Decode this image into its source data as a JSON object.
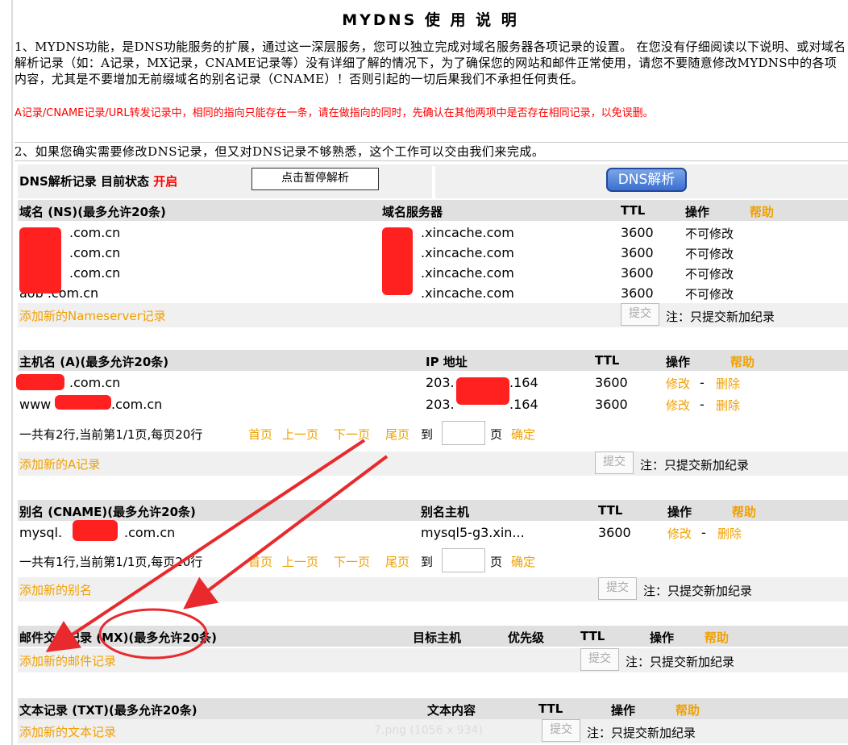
{
  "title": "MYDNS 使 用 说 明",
  "notice": {
    "para1": "1、MYDNS功能，是DNS功能服务的扩展，通过这一深层服务，您可以独立完成对域名服务器各项记录的设置。 在您没有仔细阅读以下说明、或对域名解析记录（如：A记录，MX记录，CNAME记录等）没有详细了解的情况下，为了确保您的网站和邮件正常使用，请您不要随意修改MYDNS中的各项内容，尤其是不要增加无前缀域名的别名记录（CNAME）！否则引起的一切后果我们不承担任何责任。",
    "red": "A记录/CNAME记录/URL转发记录中，相同的指向只能存在一条，请在做指向的同时，先确认在其他两项中是否存在相同记录，以免误删。",
    "para2": "2、如果您确实需要修改DNS记录，但又对DNS记录不够熟悉，这个工作可以交由我们来完成。"
  },
  "status": {
    "label": "DNS解析记录  目前状态",
    "state": "开启",
    "pause_button": "点击暂停解析",
    "dns_button": "DNS解析"
  },
  "ns": {
    "headers": [
      "域名 (NS)(最多允许20条)",
      "域名服务器",
      "TTL",
      "操作",
      "帮助"
    ],
    "rows": [
      {
        "domain": ".com.cn",
        "server": ".xincache.com",
        "ttl": "3600",
        "op": "不可修改"
      },
      {
        "domain": ".com.cn",
        "server": ".xincache.com",
        "ttl": "3600",
        "op": "不可修改"
      },
      {
        "domain": ".com.cn",
        "server": ".xincache.com",
        "ttl": "3600",
        "op": "不可修改"
      },
      {
        "domain": "aob .com.cn",
        "server": ".xincache.com",
        "ttl": "3600",
        "op": "不可修改"
      }
    ],
    "add": "添加新的Nameserver记录",
    "submit": "提交",
    "note": "注：只提交新加纪录"
  },
  "a": {
    "headers": [
      "主机名 (A)(最多允许20条)",
      "IP 地址",
      "TTL",
      "操作",
      "帮助"
    ],
    "rows": [
      {
        "host": ".com.cn",
        "ip": "203.",
        "ip_end": ".164",
        "ttl": "3600",
        "edit": "修改",
        "sep": "-",
        "del": "删除"
      },
      {
        "host": "www",
        "host_end": ".com.cn",
        "ip": "203.",
        "ip_end": ".164",
        "ttl": "3600",
        "edit": "修改",
        "sep": "-",
        "del": "删除"
      }
    ],
    "pager": {
      "info": "一共有2行,当前第1/1页,每页20行",
      "first": "首页",
      "prev": "上一页",
      "next": "下一页",
      "last": "尾页",
      "to": "到",
      "page": "页",
      "go": "确定"
    },
    "add": "添加新的A记录",
    "submit": "提交",
    "note": "注：只提交新加纪录"
  },
  "cname": {
    "headers": [
      "别名 (CNAME)(最多允许20条)",
      "别名主机",
      "TTL",
      "操作",
      "帮助"
    ],
    "rows": [
      {
        "alias": "mysql.",
        "alias_end": ".com.cn",
        "target": "mysql5-g3.xin...",
        "ttl": "3600",
        "edit": "修改",
        "sep": "-",
        "del": "删除"
      }
    ],
    "pager": {
      "info": "一共有1行,当前第1/1页,每页20行",
      "first": "首页",
      "prev": "上一页",
      "next": "下一页",
      "last": "尾页",
      "to": "到",
      "page": "页",
      "go": "确定"
    },
    "add": "添加新的别名",
    "submit": "提交",
    "note": "注：只提交新加纪录"
  },
  "mx": {
    "headers": [
      "邮件交换记录 (MX)(最多允许20条)",
      "目标主机",
      "优先级",
      "TTL",
      "操作",
      "帮助"
    ],
    "add": "添加新的邮件记录",
    "submit": "提交",
    "note": "注：只提交新加纪录"
  },
  "txt": {
    "headers": [
      "文本记录 (TXT)(最多允许20条)",
      "文本内容",
      "TTL",
      "操作",
      "帮助"
    ],
    "add": "添加新的文本记录",
    "submit": "提交",
    "note": "注：只提交新加纪录"
  },
  "watermark": "7.png (1056 x 934)",
  "annotation_color": "#e8292e"
}
